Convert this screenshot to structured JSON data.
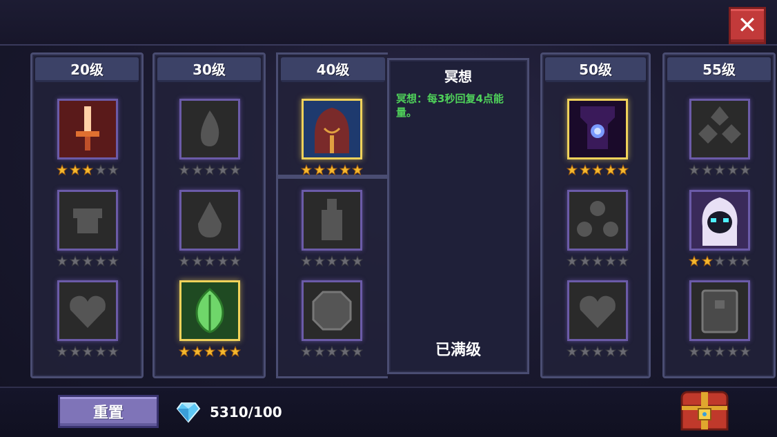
{
  "columns": [
    {
      "label": "20级",
      "skills": [
        {
          "icon": "glowing-sword-icon",
          "stars": 3,
          "active": false,
          "equipped": true
        },
        {
          "icon": "armor-chest-icon",
          "stars": 0,
          "active": false,
          "equipped": false
        },
        {
          "icon": "heart-icon",
          "stars": 0,
          "active": false,
          "equipped": false
        }
      ]
    },
    {
      "label": "30级",
      "skills": [
        {
          "icon": "flame-icon",
          "stars": 0,
          "active": false,
          "equipped": false
        },
        {
          "icon": "water-drop-icon",
          "stars": 0,
          "active": false,
          "equipped": false
        },
        {
          "icon": "leaf-icon",
          "stars": 5,
          "active": true,
          "equipped": true
        }
      ]
    },
    {
      "label": "40级",
      "skills": [
        {
          "icon": "meditating-hooded-icon",
          "stars": 5,
          "active": true,
          "equipped": true
        },
        {
          "icon": "sword-hilt-icon",
          "stars": 0,
          "active": false,
          "equipped": false
        },
        {
          "icon": "octagon-shield-icon",
          "stars": 0,
          "active": false,
          "equipped": false
        }
      ]
    },
    {
      "label": "50级",
      "skills": [
        {
          "icon": "dark-crystal-armor-icon",
          "stars": 5,
          "active": true,
          "equipped": true
        },
        {
          "icon": "triple-orb-icon",
          "stars": 0,
          "active": false,
          "equipped": false
        },
        {
          "icon": "heart-icon",
          "stars": 0,
          "active": false,
          "equipped": false
        }
      ]
    },
    {
      "label": "55级",
      "skills": [
        {
          "icon": "rock-pile-icon",
          "stars": 0,
          "active": false,
          "equipped": false
        },
        {
          "icon": "white-hooded-ghost-icon",
          "stars": 2,
          "active": false,
          "equipped": true
        },
        {
          "icon": "spellbook-icon",
          "stars": 0,
          "active": false,
          "equipped": false
        }
      ]
    }
  ],
  "detail": {
    "title": "冥想",
    "description": "冥想：每3秒回复4点能量。",
    "status": "已满级"
  },
  "bottom": {
    "reset_label": "重置",
    "gem_count": "5310/100"
  },
  "colors": {
    "accent_green": "#4fd25a",
    "gold_border": "#f0d25a",
    "purple_border": "#6b5ba8",
    "close_red": "#c23a3a",
    "reset_purple": "#7f74b8"
  }
}
